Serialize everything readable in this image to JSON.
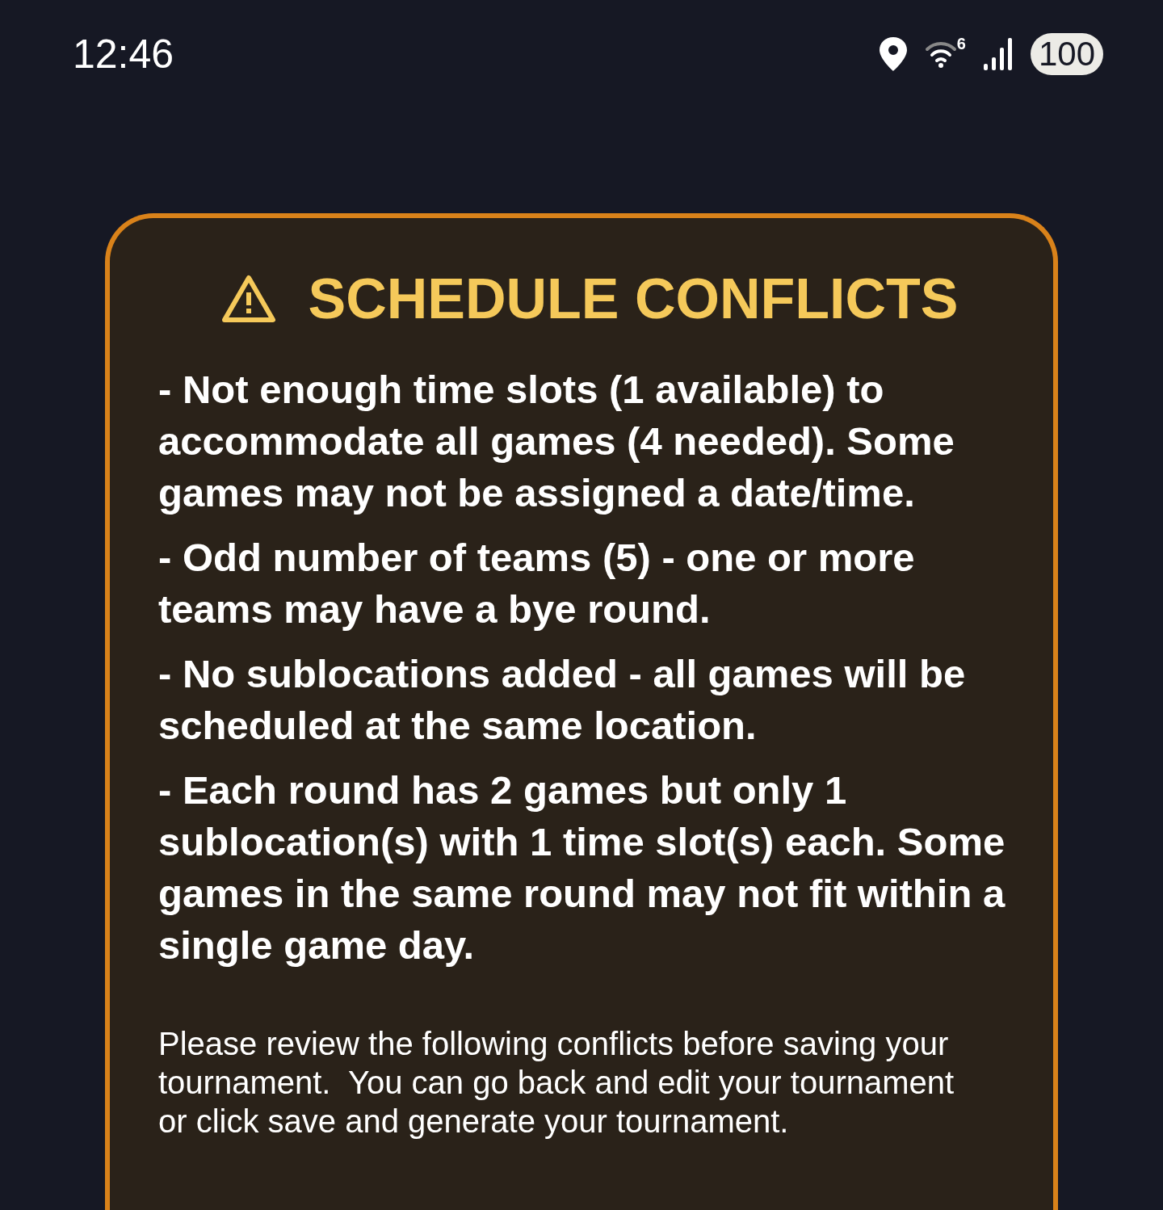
{
  "status_bar": {
    "time": "12:46",
    "wifi_badge": "6",
    "battery": "100"
  },
  "dialog": {
    "title": "SCHEDULE CONFLICTS",
    "conflicts": [
      "- Not enough time slots (1 available) to accommodate all games (4 needed). Some games may not be assigned a date/time.",
      "- Odd number of teams (5) - one or more teams may have a bye round.",
      "- No sublocations added - all games will be scheduled at the same location.",
      "- Each round has 2 games but only 1 sublocation(s) with 1 time slot(s) each. Some games in the same round may not fit within a single game day."
    ],
    "message": "Please review the following conflicts before saving your tournament.  You can go back and edit your tournament or click save and generate your tournament."
  }
}
